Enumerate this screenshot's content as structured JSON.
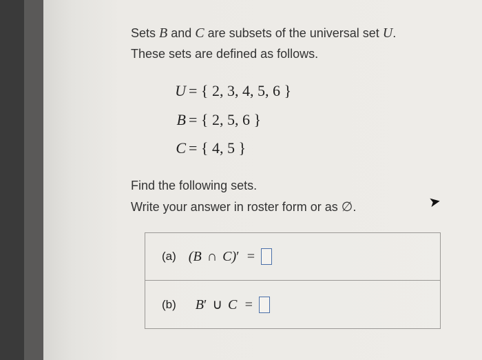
{
  "intro": {
    "line1_pre": "Sets ",
    "set_b": "B",
    "line1_mid": " and ",
    "set_c": "C",
    "line1_post": " are subsets of the universal set ",
    "set_u": "U",
    "line1_end": ".",
    "line2": "These sets are defined as follows."
  },
  "defs": {
    "u_label": "U",
    "u_set": "= { 2, 3, 4, 5, 6 }",
    "b_label": "B",
    "b_set": "= { 2, 5, 6 }",
    "c_label": "C",
    "c_set": "= { 4, 5 }"
  },
  "instructions": {
    "line1": "Find the following sets.",
    "line2_pre": "Write your answer in roster form or as ",
    "empty_symbol": "∅",
    "line2_end": "."
  },
  "parts": {
    "a": {
      "label": "(a)",
      "expr_html": "(B ∩ C)′  ="
    },
    "b": {
      "label": "(b)",
      "expr_html": "B′ ∪ C  ="
    }
  },
  "cursor_glyph": "➤"
}
